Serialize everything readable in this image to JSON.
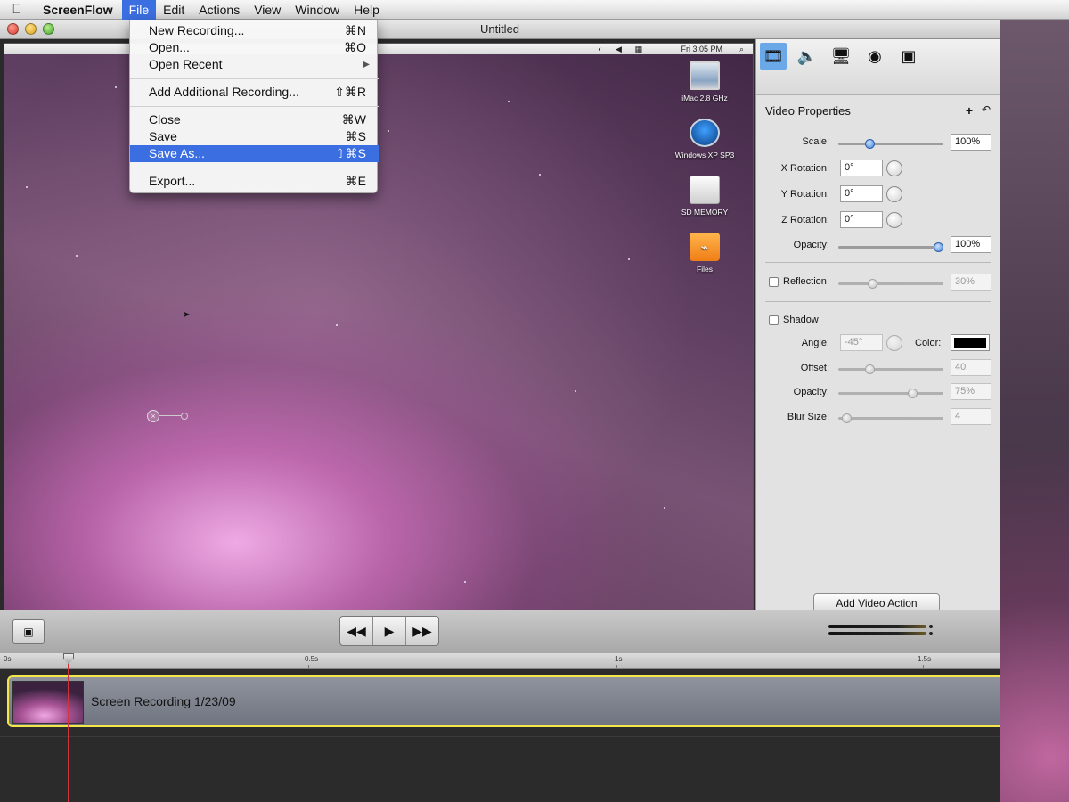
{
  "menubar": {
    "app_name": "ScreenFlow",
    "menus": [
      "File",
      "Edit",
      "Actions",
      "View",
      "Window",
      "Help"
    ]
  },
  "window": {
    "title": "Untitled"
  },
  "file_menu": {
    "items": [
      {
        "label": "New Recording...",
        "shortcut": "⌘N"
      },
      {
        "label": "Open...",
        "shortcut": "⌘O"
      },
      {
        "label": "Open Recent",
        "shortcut": ""
      },
      {
        "label": "Add Additional Recording...",
        "shortcut": "⇧⌘R"
      },
      {
        "label": "Close",
        "shortcut": "⌘W"
      },
      {
        "label": "Save",
        "shortcut": "⌘S"
      },
      {
        "label": "Save As...",
        "shortcut": "⇧⌘S"
      },
      {
        "label": "Export...",
        "shortcut": "⌘E"
      }
    ],
    "highlighted": "Save As..."
  },
  "preview": {
    "inner_clock": "Fri 3:05 PM",
    "desktop_icons": [
      {
        "label": "iMac 2.8 GHz",
        "icon": "imac-icon"
      },
      {
        "label": "Windows XP SP3",
        "icon": "windows-icon"
      },
      {
        "label": "SD MEMORY",
        "icon": "drive-icon"
      },
      {
        "label": "Files",
        "icon": "files-icon"
      }
    ]
  },
  "panel": {
    "title": "Video Properties",
    "add_symbol": "+",
    "undo_symbol": "↶",
    "tabs": [
      "video-tab-icon",
      "audio-tab-icon",
      "screen-tab-icon",
      "cursor-tab-icon",
      "callout-tab-icon"
    ],
    "scale": {
      "label": "Scale:",
      "value": "100%",
      "level": 0.28
    },
    "x_rotation": {
      "label": "X Rotation:",
      "value": "0°"
    },
    "y_rotation": {
      "label": "Y Rotation:",
      "value": "0°"
    },
    "z_rotation": {
      "label": "Z Rotation:",
      "value": "0°"
    },
    "opacity": {
      "label": "Opacity:",
      "value": "100%",
      "level": 1.0
    },
    "reflection": {
      "label": "Reflection",
      "value": "30%",
      "checked": false
    },
    "shadow": {
      "label": "Shadow",
      "checked": false,
      "angle_label": "Angle:",
      "angle_value": "-45°",
      "color_label": "Color:",
      "color": "#000000",
      "offset_label": "Offset:",
      "offset_value": "40",
      "opacity_label": "Opacity:",
      "opacity_value": "75%",
      "blur_label": "Blur Size:",
      "blur_value": "4"
    },
    "add_action_label": "Add Video Action"
  },
  "transport": {
    "rewind": "◀◀",
    "play": "▶",
    "forward": "▶▶"
  },
  "timeline": {
    "ticks": [
      "0s",
      "0.5s",
      "1s",
      "1.5s"
    ],
    "clip_label": "Screen Recording 1/23/09"
  },
  "colors": {
    "accent": "#3b6ee0",
    "clip_border": "#f2e64a",
    "playhead": "#d0343a"
  }
}
